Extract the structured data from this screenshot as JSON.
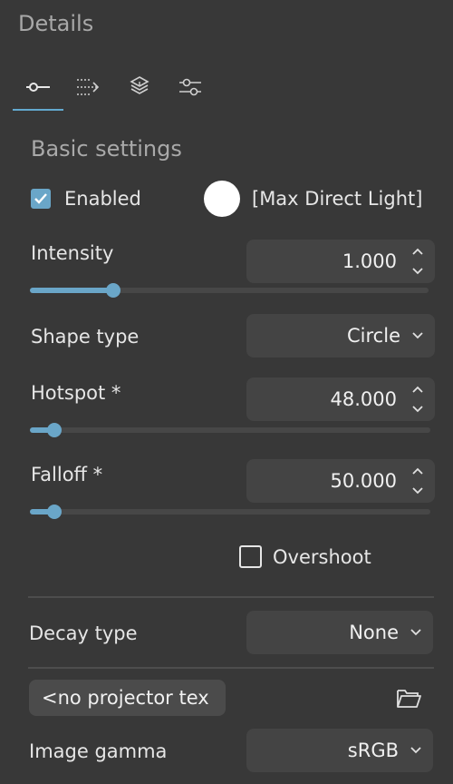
{
  "panel": {
    "title": "Details"
  },
  "tabs": [
    {
      "icon": "light-settings-icon",
      "active": true
    },
    {
      "icon": "flow-arrows-icon",
      "active": false
    },
    {
      "icon": "layers-icon",
      "active": false
    },
    {
      "icon": "sliders-icon",
      "active": false
    }
  ],
  "section": {
    "title": "Basic settings"
  },
  "enabled": {
    "label": "Enabled",
    "checked": true
  },
  "color_swatch": {
    "color": "#ffffff"
  },
  "mode": {
    "label": "[Max Direct Light]"
  },
  "intensity": {
    "label": "Intensity",
    "value": "1.000",
    "slider_fraction": 0.21
  },
  "shape_type": {
    "label": "Shape type",
    "value": "Circle"
  },
  "hotspot": {
    "label": "Hotspot *",
    "value": "48.000",
    "slider_fraction": 0.06
  },
  "falloff": {
    "label": "Falloff *",
    "value": "50.000",
    "slider_fraction": 0.06
  },
  "overshoot": {
    "label": "Overshoot",
    "checked": false
  },
  "decay_type": {
    "label": "Decay type",
    "value": "None"
  },
  "projector": {
    "label": "<no projector tex"
  },
  "image_gamma": {
    "label": "Image gamma",
    "value": "sRGB"
  },
  "colors": {
    "accent": "#6aa6c8",
    "background": "#383838",
    "control_bg": "#444444"
  }
}
